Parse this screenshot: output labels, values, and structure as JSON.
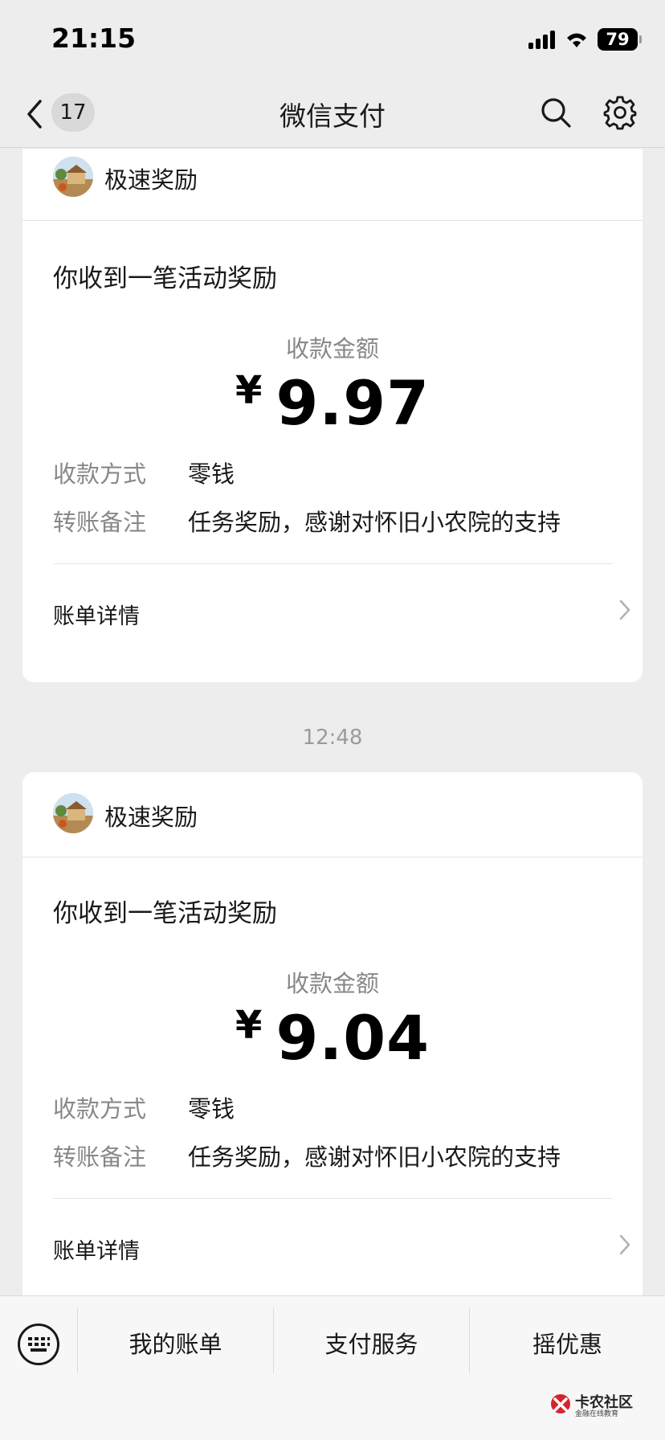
{
  "status_bar": {
    "time": "21:15",
    "battery": "79"
  },
  "nav": {
    "unread_count": "17",
    "title": "微信支付"
  },
  "messages": [
    {
      "sender": "极速奖励",
      "title": "你收到一笔活动奖励",
      "amount_label": "收款金额",
      "currency": "¥",
      "amount": "9.97",
      "method_key": "收款方式",
      "method_value": "零钱",
      "note_key": "转账备注",
      "note_value": "任务奖励，感谢对怀旧小农院的支持",
      "detail_label": "账单详情"
    },
    {
      "timestamp": "12:48",
      "sender": "极速奖励",
      "title": "你收到一笔活动奖励",
      "amount_label": "收款金额",
      "currency": "¥",
      "amount": "9.04",
      "method_key": "收款方式",
      "method_value": "零钱",
      "note_key": "转账备注",
      "note_value": "任务奖励，感谢对怀旧小农院的支持",
      "detail_label": "账单详情"
    }
  ],
  "bottom_menu": {
    "items": [
      "我的账单",
      "支付服务",
      "摇优惠"
    ]
  },
  "watermark": {
    "title": "卡农社区",
    "subtitle": "金融在线教育"
  },
  "icons": [
    "back-arrow-icon",
    "search-icon",
    "gear-icon",
    "keyboard-icon",
    "chevron-right-icon"
  ]
}
